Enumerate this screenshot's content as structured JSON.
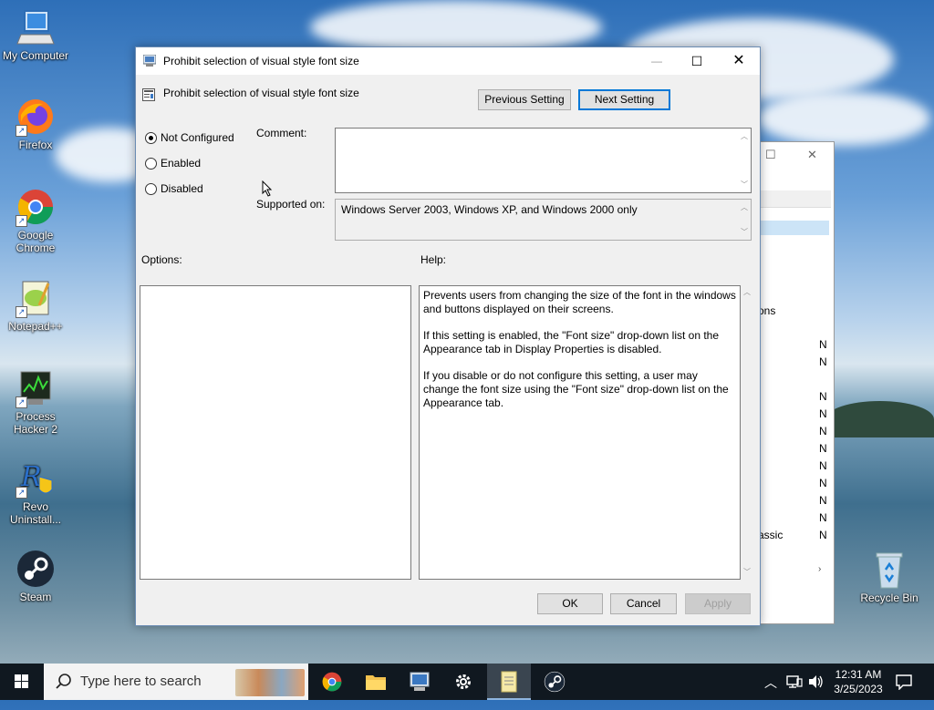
{
  "desktop": {
    "icons": [
      {
        "label": "My Computer",
        "icon": "computer-icon"
      },
      {
        "label": "Firefox",
        "icon": "firefox-icon"
      },
      {
        "label": "Google Chrome",
        "icon": "chrome-icon"
      },
      {
        "label": "Notepad++",
        "icon": "notepadpp-icon"
      },
      {
        "label": "Process Hacker 2",
        "icon": "process-hacker-icon"
      },
      {
        "label": "Revo Uninstall...",
        "icon": "revo-uninstaller-icon"
      },
      {
        "label": "Steam",
        "icon": "steam-icon"
      },
      {
        "label": "Recycle Bin",
        "icon": "recycle-bin-icon"
      }
    ]
  },
  "bg_window": {
    "partial_labels": [
      "ons",
      "assic"
    ],
    "column_values": [
      "N",
      "N",
      "N",
      "N",
      "N",
      "N",
      "N",
      "N",
      "N",
      "N",
      "N"
    ]
  },
  "dialog": {
    "title": "Prohibit selection of visual style font size",
    "header_title": "Prohibit selection of visual style font size",
    "prev_label": "Previous Setting",
    "next_label": "Next Setting",
    "radios": {
      "not_configured": "Not Configured",
      "enabled": "Enabled",
      "disabled": "Disabled",
      "selected": "not_configured"
    },
    "comment_label": "Comment:",
    "comment_value": "",
    "supported_label": "Supported on:",
    "supported_value": "Windows Server 2003, Windows XP, and Windows 2000 only",
    "options_label": "Options:",
    "help_label": "Help:",
    "help_paragraphs": [
      "Prevents users from changing the size of the font in the windows and buttons displayed on their screens.",
      "If this setting is enabled, the \"Font size\" drop-down list on the Appearance tab in Display Properties is disabled.",
      "If you disable or do not configure this setting, a user may change the font size using the \"Font size\" drop-down list on the Appearance tab."
    ],
    "ok_label": "OK",
    "cancel_label": "Cancel",
    "apply_label": "Apply",
    "window_buttons": {
      "minimize": "—",
      "maximize": "☐",
      "close": "✕"
    }
  },
  "taskbar": {
    "search_placeholder": "Type here to search",
    "apps": [
      "chrome-icon",
      "file-explorer-icon",
      "group-policy-icon",
      "settings-gear-icon",
      "notepad-icon",
      "steam-icon"
    ],
    "time": "12:31 AM",
    "date": "3/25/2023"
  },
  "colors": {
    "accent": "#0078d7",
    "taskbar": "#101820"
  }
}
